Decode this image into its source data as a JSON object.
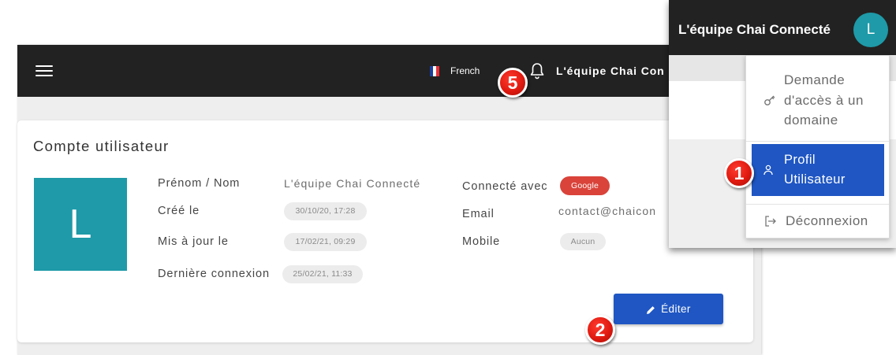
{
  "topbar": {
    "menu_icon": "hamburger-menu-icon",
    "language_flag": "french-flag-icon",
    "language": "French",
    "bell_icon": "bell-icon",
    "user_name": "L'équipe Chai Con"
  },
  "card": {
    "title": "Compte utilisateur",
    "avatar_letter": "L",
    "left_fields": [
      {
        "label": "Prénom / Nom",
        "value": "L'équipe Chai Connecté"
      },
      {
        "label": "Créé le",
        "value": "30/10/20, 17:28"
      },
      {
        "label": "Mis à jour le",
        "value": "17/02/21, 09:29"
      },
      {
        "label": "Dernière connexion",
        "value": "25/02/21, 11:33"
      }
    ],
    "right_fields": [
      {
        "label": "Connecté avec",
        "value": "Google"
      },
      {
        "label": "Email",
        "value": "contact@chaicon"
      },
      {
        "label": "Mobile",
        "value": "Aucun"
      }
    ],
    "edit_icon": "pencil-icon",
    "edit_button": "Éditer"
  },
  "user_menu": {
    "header_name": "L'équipe Chai Connecté",
    "avatar_letter": "L",
    "items": [
      {
        "label": "Demande d'accès à un domaine",
        "icon": "key-icon",
        "active": false
      },
      {
        "label": "Profil Utilisateur",
        "icon": "user-icon",
        "active": true
      },
      {
        "label": "Déconnexion",
        "icon": "logout-icon",
        "active": false
      }
    ]
  },
  "badges": {
    "step_5": "5",
    "step_1": "1",
    "step_2": "2"
  },
  "colors": {
    "topbar": "#222222",
    "page_bg": "#eeeeee",
    "accent_blue": "#1f56c3",
    "avatar_teal": "#1e9aa8",
    "google_red": "#d9433a",
    "badge_red": "#e01a10"
  }
}
